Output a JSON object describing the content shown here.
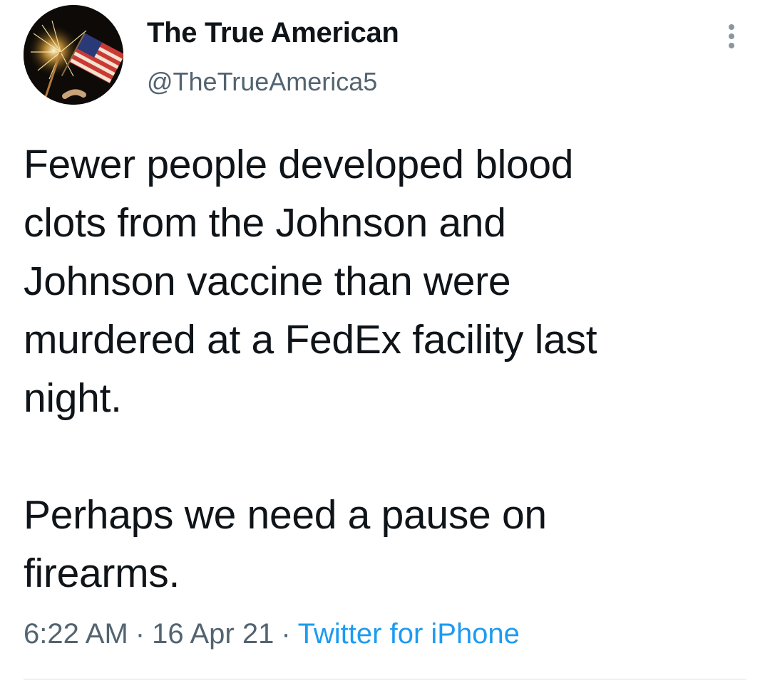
{
  "tweet": {
    "author": {
      "display_name": "The True American",
      "handle": "@TheTrueAmerica5",
      "avatar_icon": "sparkler-flag-avatar"
    },
    "more_icon": "more-vertical-icon",
    "paragraphs": [
      "Fewer people developed blood\nclots from the Johnson and\nJohnson vaccine than were\nmurdered at a FedEx facility last\nnight.",
      "Perhaps we need a pause on\nfirearms."
    ],
    "meta": {
      "time": "6:22 AM",
      "date": "16 Apr 21",
      "separator": "·",
      "source": "Twitter for iPhone"
    }
  },
  "colors": {
    "text": "#0f1419",
    "secondary": "#536471",
    "link": "#1d9bf0",
    "divider": "#d9dee2"
  }
}
